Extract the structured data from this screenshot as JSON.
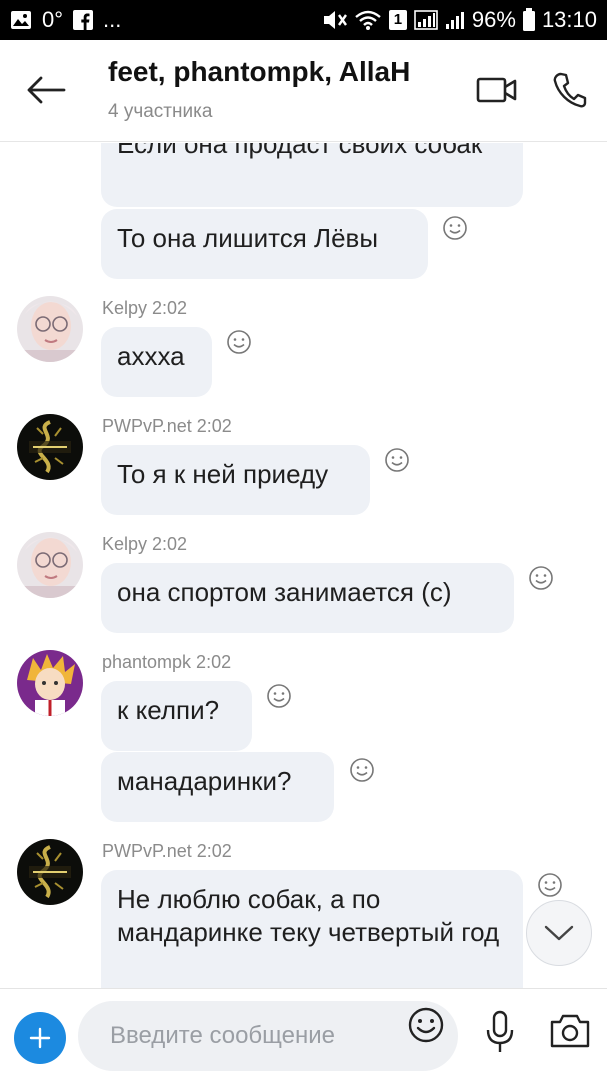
{
  "status_bar": {
    "left": {
      "temperature": "0°",
      "more": "..."
    },
    "right": {
      "sim": "1",
      "battery": "96%",
      "time": "13:10"
    }
  },
  "header": {
    "title": "feet, phantompk, AllaH",
    "subtitle": "4 участника"
  },
  "messages": [
    {
      "text": "Если она продаст своих собак"
    },
    {
      "text": "То она лишится Лёвы"
    },
    {
      "sender": "Kelpy 2:02",
      "text": "аххха"
    },
    {
      "sender": "PWPvP.net 2:02",
      "text": "То я к ней приеду"
    },
    {
      "sender": "Kelpy 2:02",
      "text": "она спортом занимается (с)"
    },
    {
      "sender": "phantompk 2:02",
      "text": "к келпи?"
    },
    {
      "text": "манадаринки?"
    },
    {
      "sender": "PWPvP.net 2:02",
      "text": "Не люблю собак, а по мандаринке теку четвертый год"
    }
  ],
  "composer": {
    "placeholder": "Введите сообщение"
  },
  "colors": {
    "accent": "#1c8ae0",
    "bubble": "#eef1f6",
    "status_bar": "#000000"
  },
  "icons": {
    "back": "arrow-left-icon",
    "video": "video-camera-icon",
    "call": "phone-icon",
    "reaction": "smiley-icon",
    "scroll": "chevron-down-icon",
    "add": "plus-icon",
    "emoji": "emoji-icon",
    "mic": "microphone-icon",
    "camera": "camera-icon"
  }
}
